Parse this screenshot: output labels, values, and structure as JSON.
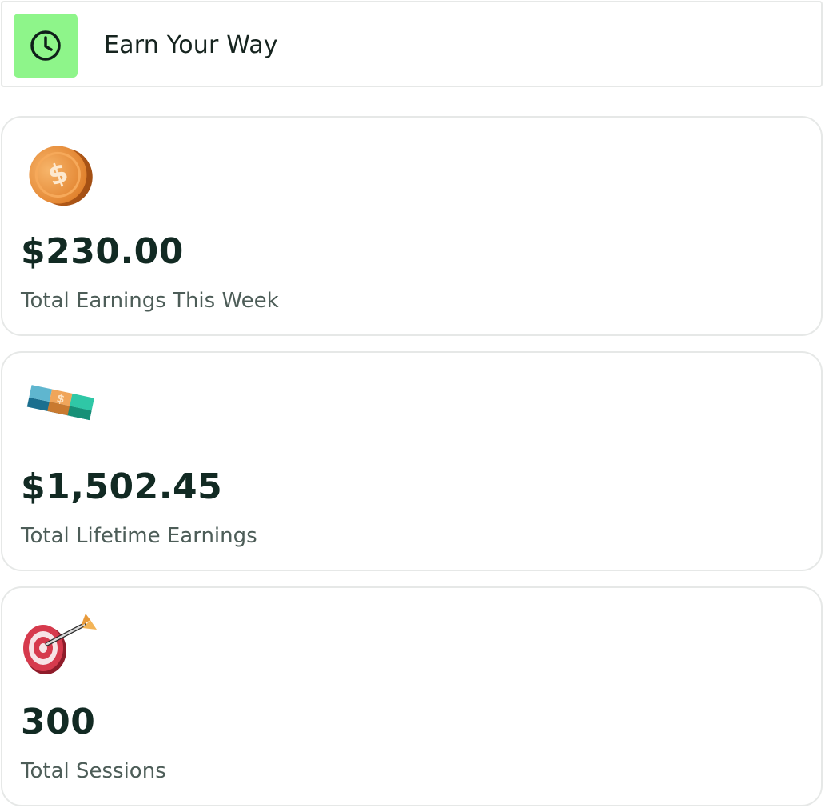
{
  "header": {
    "icon": "clock-icon",
    "title": "Earn Your Way",
    "accent_color": "#8ef58a"
  },
  "stats": [
    {
      "icon": "coin-icon",
      "value": "$230.00",
      "label": "Total Earnings This Week"
    },
    {
      "icon": "money-stack-icon",
      "value": "$1,502.45",
      "label": "Total Lifetime Earnings"
    },
    {
      "icon": "target-icon",
      "value": "300",
      "label": "Total Sessions"
    }
  ]
}
